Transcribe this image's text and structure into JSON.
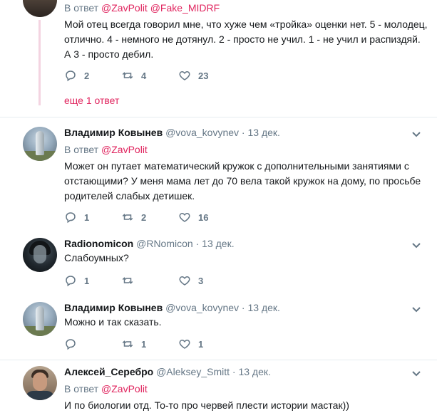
{
  "tweets": [
    {
      "reply_prefix": "В ответ",
      "reply_to_1": "@ZavPolit",
      "reply_to_2": "@Fake_MIDRF",
      "text": "Мой отец всегда говорил мне, что хуже чем «тройка» оценки нет. 5 - молодец, отлично. 4 - немного не дотянул. 2 - просто не учил. 1 - не учил и распиздяй. А 3 - просто дебил.",
      "replies": "2",
      "retweets": "4",
      "likes": "23",
      "more_replies": "еще 1 ответ"
    },
    {
      "name": "Владимир Ковынев",
      "handle": "@vova_kovynev",
      "dot": "·",
      "time": "13 дек.",
      "reply_prefix": "В ответ",
      "reply_to_1": "@ZavPolit",
      "text": "Может он путает математический кружок с дополнительными занятиями с отстающими? У меня мама лет до 70 вела такой кружок на дому, по просьбе родителей слабых детишек.",
      "replies": "1",
      "retweets": "2",
      "likes": "16"
    },
    {
      "name": "Radionomicon",
      "handle": "@RNomicon",
      "dot": "·",
      "time": "13 дек.",
      "text": "Слабоумных?",
      "replies": "1",
      "retweets": "",
      "likes": "3"
    },
    {
      "name": "Владимир Ковынев",
      "handle": "@vova_kovynev",
      "dot": "·",
      "time": "13 дек.",
      "text": "Можно и так сказать.",
      "replies": "",
      "retweets": "1",
      "likes": "1"
    },
    {
      "name": "Алексей_Серебро",
      "handle": "@Aleksey_Smitt",
      "dot": "·",
      "time": "13 дек.",
      "reply_prefix": "В ответ",
      "reply_to_1": "@ZavPolit",
      "text": "И по биологии отд. То-то про червей плести истории мастак))"
    }
  ],
  "colors": {
    "accent": "#e0245e",
    "muted": "#657786",
    "thread": "#f4d4e1"
  },
  "icons": [
    "reply-icon",
    "retweet-icon",
    "like-icon",
    "chevron-down-icon"
  ]
}
